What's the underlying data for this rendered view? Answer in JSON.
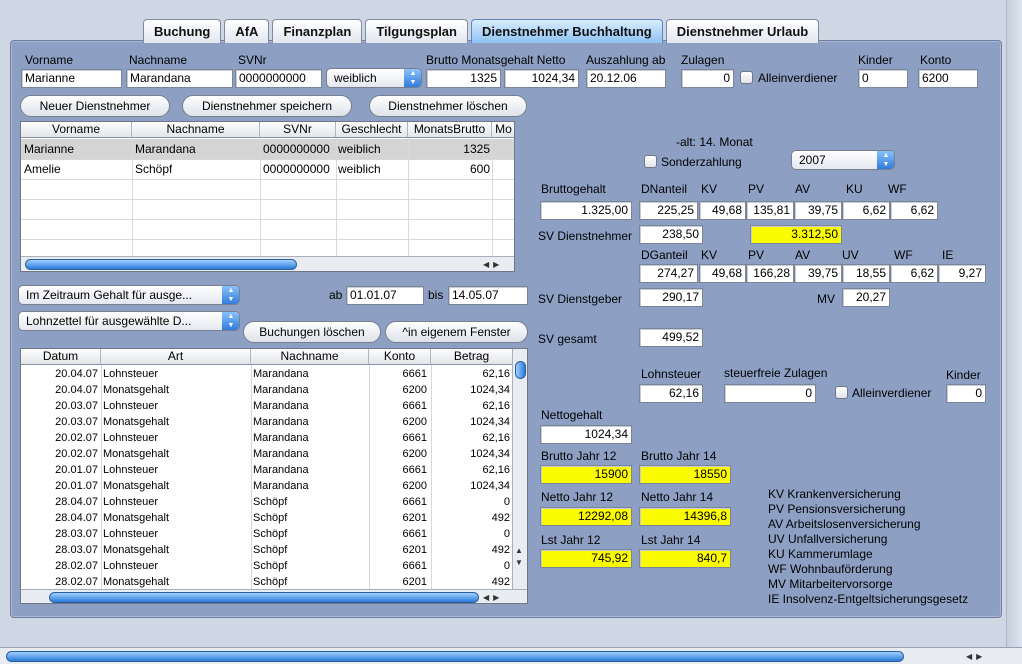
{
  "tabs": [
    "Buchung",
    "AfA",
    "Finanzplan",
    "Tilgungsplan",
    "Dienstnehmer Buchhaltung",
    "Dienstnehmer Urlaub"
  ],
  "active_tab": 4,
  "form": {
    "labels": {
      "vorname": "Vorname",
      "nachname": "Nachname",
      "svnr": "SVNr",
      "brutto": "Brutto Monatsgehalt Netto",
      "auszahlung": "Auszahlung ab",
      "zulagen": "Zulagen",
      "kinder": "Kinder",
      "konto": "Konto",
      "alleinverdiener": "Alleinverdiener"
    },
    "vorname": "Marianne",
    "nachname": "Marandana",
    "svnr": "0000000000",
    "geschlecht": "weiblich",
    "brutto": "1325",
    "netto": "1024,34",
    "auszahlung": "20.12.06",
    "zulagen": "0",
    "kinder": "0",
    "konto": "6200"
  },
  "buttons": {
    "neu": "Neuer Dienstnehmer",
    "speichern": "Dienstnehmer speichern",
    "loeschen": "Dienstnehmer löschen",
    "buchungen_loeschen": "Buchungen löschen",
    "eigenes_fenster": "^in eigenem Fenster"
  },
  "employees": {
    "columns": [
      "Vorname",
      "Nachname",
      "SVNr",
      "Geschlecht",
      "MonatsBrutto",
      "Mo"
    ],
    "rows": [
      {
        "vorname": "Marianne",
        "nachname": "Marandana",
        "svnr": "0000000000",
        "geschlecht": "weiblich",
        "brutto": "1325"
      },
      {
        "vorname": "Amelie",
        "nachname": "Schöpf",
        "svnr": "0000000000",
        "geschlecht": "weiblich",
        "brutto": "600"
      }
    ]
  },
  "filter": {
    "zeitraum": "Im Zeitraum Gehalt für ausge...",
    "lohnzettel": "Lohnzettel für ausgewählte D...",
    "ab_label": "ab",
    "ab": "01.01.07",
    "bis_label": "bis",
    "bis": "14.05.07"
  },
  "bookings": {
    "columns": [
      "Datum",
      "Art",
      "Nachname",
      "Konto",
      "Betrag"
    ],
    "rows": [
      [
        "20.04.07",
        "Lohnsteuer",
        "Marandana",
        "6661",
        "62,16"
      ],
      [
        "20.04.07",
        "Monatsgehalt",
        "Marandana",
        "6200",
        "1024,34"
      ],
      [
        "20.03.07",
        "Lohnsteuer",
        "Marandana",
        "6661",
        "62,16"
      ],
      [
        "20.03.07",
        "Monatsgehalt",
        "Marandana",
        "6200",
        "1024,34"
      ],
      [
        "20.02.07",
        "Lohnsteuer",
        "Marandana",
        "6661",
        "62,16"
      ],
      [
        "20.02.07",
        "Monatsgehalt",
        "Marandana",
        "6200",
        "1024,34"
      ],
      [
        "20.01.07",
        "Lohnsteuer",
        "Marandana",
        "6661",
        "62,16"
      ],
      [
        "20.01.07",
        "Monatsgehalt",
        "Marandana",
        "6200",
        "1024,34"
      ],
      [
        "28.04.07",
        "Lohnsteuer",
        "Schöpf",
        "6661",
        "0"
      ],
      [
        "28.04.07",
        "Monatsgehalt",
        "Schöpf",
        "6201",
        "492"
      ],
      [
        "28.03.07",
        "Lohnsteuer",
        "Schöpf",
        "6661",
        "0"
      ],
      [
        "28.03.07",
        "Monatsgehalt",
        "Schöpf",
        "6201",
        "492"
      ],
      [
        "28.02.07",
        "Lohnsteuer",
        "Schöpf",
        "6661",
        "0"
      ],
      [
        "28.02.07",
        "Monatsgehalt",
        "Schöpf",
        "6201",
        "492"
      ]
    ]
  },
  "calc": {
    "alt_label": "-alt: 14. Monat",
    "sonderzahlung": "Sonderzahlung",
    "year": "2007",
    "bruttogehalt_label": "Bruttogehalt",
    "bruttogehalt": "1.325,00",
    "dn_labels": [
      "DNanteil",
      "KV",
      "PV",
      "AV",
      "KU",
      "WF"
    ],
    "dn_values": [
      "225,25",
      "49,68",
      "135,81",
      "39,75",
      "6,62",
      "6,62"
    ],
    "sv_dn_label": "SV Dienstnehmer",
    "sv_dn": "238,50",
    "sv_dn_highlight": "3.312,50",
    "dg_labels": [
      "DGanteil",
      "KV",
      "PV",
      "AV",
      "UV",
      "WF",
      "IE"
    ],
    "dg_values": [
      "274,27",
      "49,68",
      "166,28",
      "39,75",
      "18,55",
      "6,62",
      "9,27"
    ],
    "sv_dg_label": "SV Dienstgeber",
    "sv_dg": "290,17",
    "mv_label": "MV",
    "mv": "20,27",
    "sv_gesamt_label": "SV gesamt",
    "sv_gesamt": "499,52",
    "lohnsteuer_label": "Lohnsteuer",
    "lohnsteuer": "62,16",
    "stf_zulagen_label": "steuerfreie Zulagen",
    "stf_zulagen": "0",
    "alleinverdiener": "Alleinverdiener",
    "kinder_label": "Kinder",
    "kinder": "0",
    "nettogehalt_label": "Nettogehalt",
    "nettogehalt": "1024,34",
    "brutto12_label": "Brutto Jahr 12",
    "brutto12": "15900",
    "brutto14_label": "Brutto Jahr 14",
    "brutto14": "18550",
    "netto12_label": "Netto Jahr 12",
    "netto12": "12292,08",
    "netto14_label": "Netto Jahr 14",
    "netto14": "14396,8",
    "lst12_label": "Lst Jahr 12",
    "lst12": "745,92",
    "lst14_label": "Lst Jahr 14",
    "lst14": "840,7"
  },
  "legend": [
    "KV Krankenversicherung",
    "PV Pensionsversicherung",
    "AV Arbeitslosenversicherung",
    "UV Unfallversicherung",
    "KU Kammerumlage",
    "WF Wohnbauförderung",
    "MV Mitarbeitervorsorge",
    "IE Insolvenz-Entgeltsicherungsgesetz"
  ],
  "colors": {
    "highlight": "#fcfc00",
    "panel": "#8da0c4",
    "accent": "#2a78d8"
  }
}
